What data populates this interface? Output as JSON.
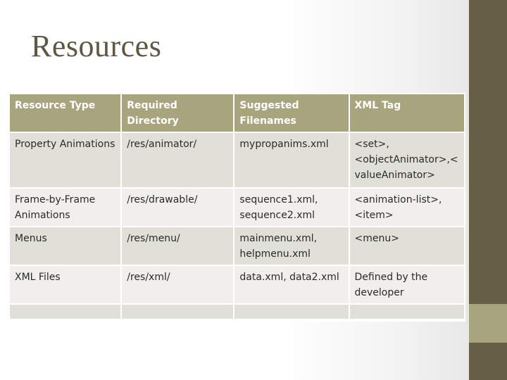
{
  "slide": {
    "title": "Resources",
    "colors": {
      "title": "#5e5744",
      "side_band": "#675e47",
      "side_accent": "#a8a47e",
      "header_row": "#a8a47e",
      "row_odd": "#e0e0d9",
      "row_even": "#f0efec"
    }
  },
  "table": {
    "headers": [
      "Resource Type",
      "Required Directory",
      "Suggested Filenames",
      "XML Tag"
    ],
    "rows": [
      [
        "Property Animations",
        "/res/animator/",
        "mypropanims.xml",
        "<set>, <objectAnimator>,< valueAnimator>"
      ],
      [
        "Frame-by-Frame Animations",
        "/res/drawable/",
        "sequence1.xml, sequence2.xml",
        "<animation-list>, <item>"
      ],
      [
        "Menus",
        "/res/menu/",
        "mainmenu.xml, helpmenu.xml",
        "<menu>"
      ],
      [
        "XML Files",
        "/res/xml/",
        "data.xml, data2.xml",
        "Defined by the developer"
      ],
      [
        "",
        "",
        "",
        ""
      ]
    ]
  }
}
